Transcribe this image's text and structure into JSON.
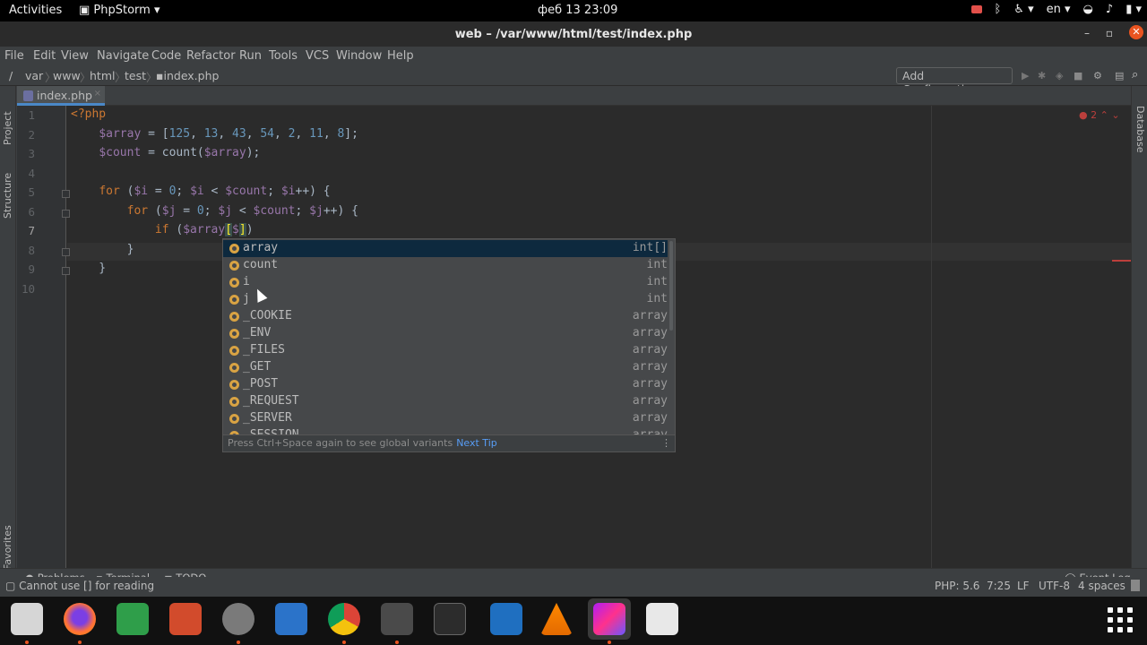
{
  "topbar": {
    "activities": "Activities",
    "app_name": "PhpStorm",
    "clock": "фeб 13  23:09",
    "language": "en"
  },
  "window": {
    "title": "web – /var/www/html/test/index.php"
  },
  "menu": [
    "File",
    "Edit",
    "View",
    "Navigate",
    "Code",
    "Refactor",
    "Run",
    "Tools",
    "VCS",
    "Window",
    "Help"
  ],
  "breadcrumbs": [
    "/",
    "var",
    "www",
    "html",
    "test",
    "index.php"
  ],
  "toolbar": {
    "add_configuration": "Add Configuration..."
  },
  "side_tools": {
    "project": "Project",
    "structure": "Structure",
    "favorites": "Favorites",
    "database": "Database"
  },
  "tab": {
    "label": "index.php"
  },
  "inspection": {
    "count": "2"
  },
  "line_numbers": [
    "1",
    "2",
    "3",
    "4",
    "5",
    "6",
    "7",
    "8",
    "9",
    "10"
  ],
  "completion": {
    "items": [
      {
        "name": "array",
        "type": "int[]"
      },
      {
        "name": "count",
        "type": "int"
      },
      {
        "name": "i",
        "type": "int"
      },
      {
        "name": "j",
        "type": "int"
      },
      {
        "name": "_COOKIE",
        "type": "array"
      },
      {
        "name": "_ENV",
        "type": "array"
      },
      {
        "name": "_FILES",
        "type": "array"
      },
      {
        "name": "_GET",
        "type": "array"
      },
      {
        "name": "_POST",
        "type": "array"
      },
      {
        "name": "_REQUEST",
        "type": "array"
      },
      {
        "name": "_SERVER",
        "type": "array"
      },
      {
        "name": "_SESSION",
        "type": "array"
      }
    ],
    "footer": "Press Ctrl+Space again to see global variants",
    "next_tip": "Next Tip"
  },
  "bottom_tools": {
    "problems": "Problems",
    "terminal": "Terminal",
    "todo": "TODO",
    "event_log": "Event Log"
  },
  "status": {
    "message": "Cannot use [] for reading",
    "php": "PHP: 5.6",
    "position": "7:25",
    "line_sep": "LF",
    "encoding": "UTF-8",
    "indent": "4 spaces"
  },
  "colors": {
    "editor_bg": "#2b2b2b",
    "keyword": "#cc7832",
    "variable": "#9876aa",
    "number": "#6897bb",
    "accent": "#4a88c7"
  }
}
